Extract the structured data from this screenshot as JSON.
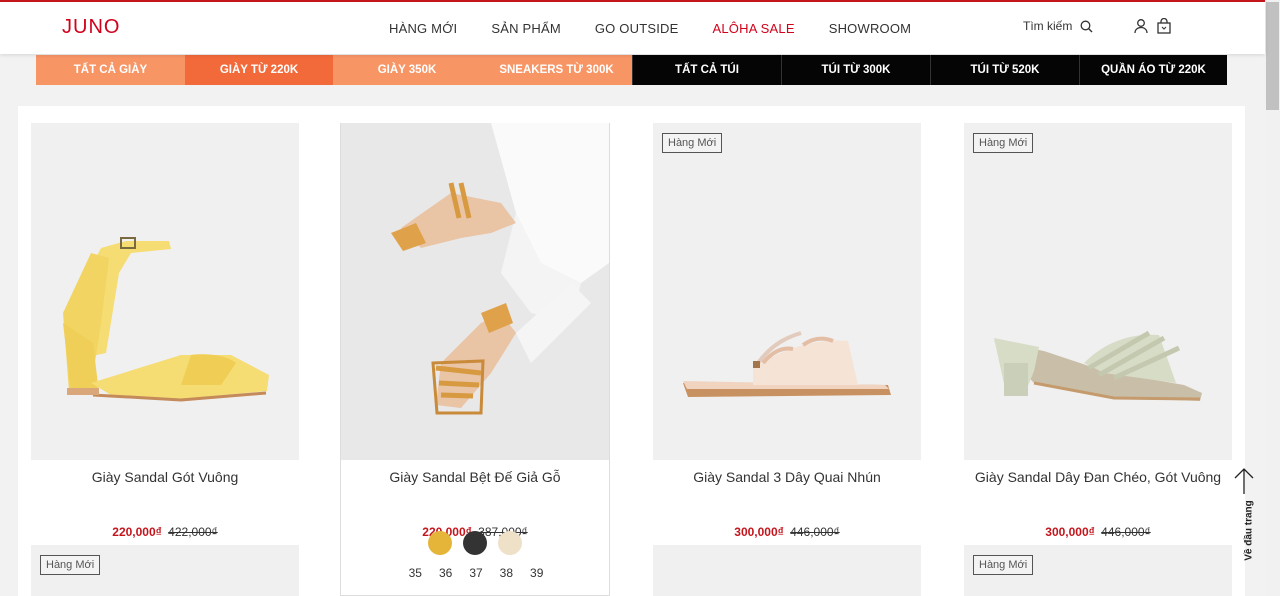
{
  "header": {
    "logo": "JUNO",
    "nav": [
      "HÀNG MỚI",
      "SẢN PHẨM",
      "GO OUTSIDE",
      "ALÔHA SALE",
      "SHOWROOM"
    ],
    "search_label": "Tìm kiếm"
  },
  "categories": [
    "TẤT CẢ GIÀY",
    "GIÀY TỪ 220K",
    "GIÀY 350K",
    "SNEAKERS TỪ 300K",
    "TẤT CẢ TÚI",
    "TÚI TỪ 300K",
    "TÚI TỪ 520K",
    "QUẦN ÁO TỪ 220K"
  ],
  "products": [
    {
      "name": "Giày Sandal Gót Vuông",
      "price": "220,000₫",
      "old_price": "422,000₫"
    },
    {
      "name": "Giày Sandal Bệt Đế Giả Gỗ",
      "price": "220,000₫",
      "old_price": "387,000₫"
    },
    {
      "name": "Giày Sandal 3 Dây Quai Nhún",
      "price": "300,000₫",
      "old_price": "446,000₫",
      "badge": "Hàng Mới"
    },
    {
      "name": "Giày Sandal Dây Đan Chéo, Gót Vuông",
      "price": "300,000₫",
      "old_price": "446,000₫",
      "badge": "Hàng Mới"
    }
  ],
  "second_row_badges": [
    "Hàng Mới",
    "Hàng Mới"
  ],
  "swatch_colors": [
    "#e5b53a",
    "#333333",
    "#efe0c8"
  ],
  "sizes": [
    "35",
    "36",
    "37",
    "38",
    "39"
  ],
  "back_to_top": "Về đầu trang",
  "colors": {
    "brand": "#d0021b",
    "sale_price": "#c4151c",
    "cat_active": "#f26a3a",
    "cat_light": "#f79565",
    "cat_dark": "#050505"
  }
}
